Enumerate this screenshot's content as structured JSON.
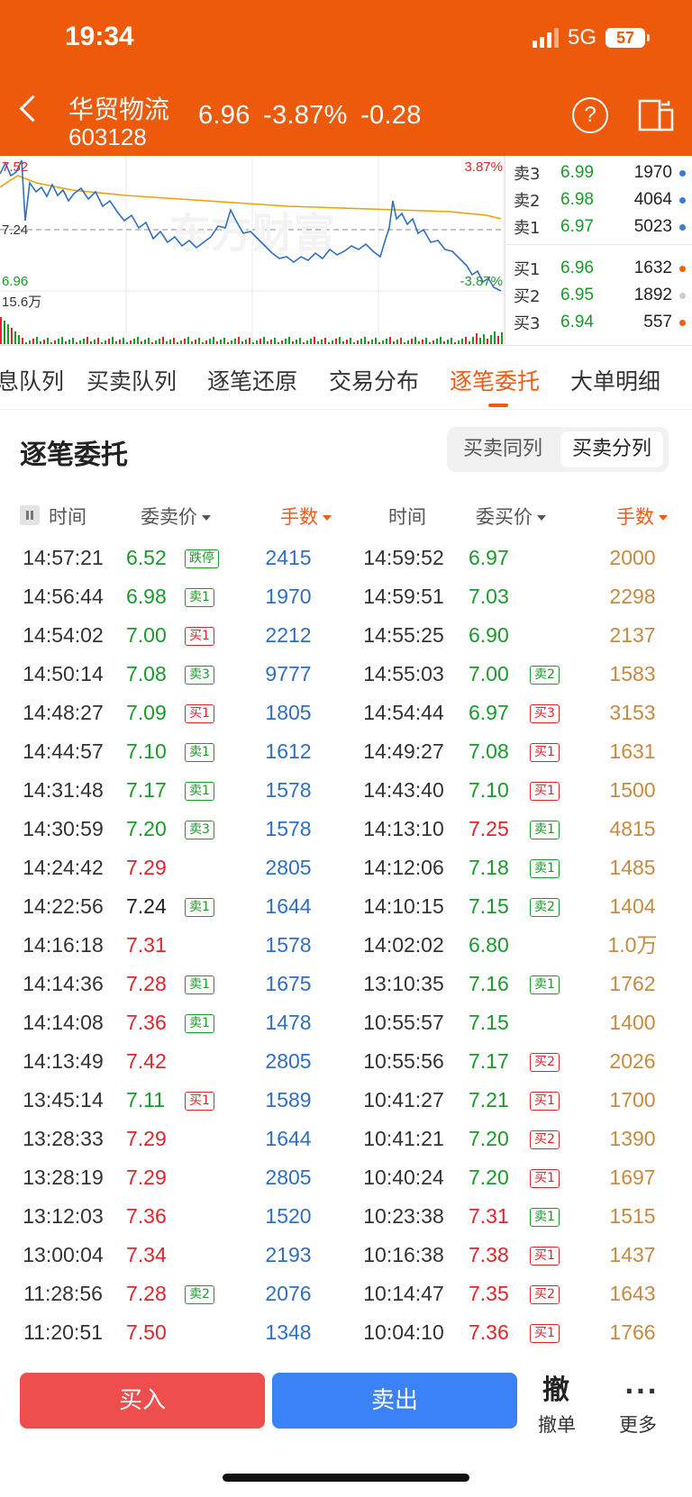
{
  "status_bar": {
    "time": "19:34",
    "network": "5G",
    "battery": "57"
  },
  "header": {
    "stock_name": "华贸物流",
    "stock_code": "603128",
    "price": "6.96",
    "change_pct": "-3.87%",
    "change": "-0.28"
  },
  "chart": {
    "price_high_label": "7.52",
    "price_low_label": "6.96",
    "pct_high_label": "3.87%",
    "pct_low_label": "-3.87%",
    "ref_label": "7.24",
    "volume_label": "15.6万",
    "watermark": "东方财富",
    "colors": {
      "price_line": "#2f6fc0",
      "avg_line": "#f0a000",
      "up": "#e0252b",
      "down": "#1a9a2a"
    }
  },
  "orderbook": {
    "asks": [
      {
        "label": "卖3",
        "price": "6.99",
        "volume": "1970",
        "dot_color": "#3b7ad8"
      },
      {
        "label": "卖2",
        "price": "6.98",
        "volume": "4064",
        "dot_color": "#3b7ad8"
      },
      {
        "label": "卖1",
        "price": "6.97",
        "volume": "5023",
        "dot_color": "#3b7ad8"
      }
    ],
    "bids": [
      {
        "label": "买1",
        "price": "6.96",
        "volume": "1632",
        "dot_color": "#f06010"
      },
      {
        "label": "买2",
        "price": "6.95",
        "volume": "1892",
        "dot_color": "#cccccc"
      },
      {
        "label": "买3",
        "price": "6.94",
        "volume": "557",
        "dot_color": "#f06010"
      }
    ]
  },
  "tabs": [
    "息队列",
    "买卖队列",
    "逐笔还原",
    "交易分布",
    "逐笔委托",
    "大单明细"
  ],
  "active_tab": "逐笔委托",
  "section": {
    "title": "逐笔委托",
    "toggle": [
      "买卖同列",
      "买卖分列"
    ],
    "selected_toggle": "买卖分列"
  },
  "columns": {
    "left": [
      "时间",
      "委卖价",
      "手数"
    ],
    "right": [
      "时间",
      "委买价",
      "手数"
    ]
  },
  "rows": [
    {
      "lt": "14:57:21",
      "lp": "6.52",
      "lc": "g",
      "lb": "跌停",
      "lbc": "g",
      "lv": "2415",
      "rt": "14:59:52",
      "rp": "6.97",
      "rc": "g",
      "rb": "",
      "rbc": "",
      "rv": "2000"
    },
    {
      "lt": "14:56:44",
      "lp": "6.98",
      "lc": "g",
      "lb": "卖1",
      "lbc": "g",
      "lv": "1970",
      "rt": "14:59:51",
      "rp": "7.03",
      "rc": "g",
      "rb": "",
      "rbc": "",
      "rv": "2298"
    },
    {
      "lt": "14:54:02",
      "lp": "7.00",
      "lc": "g",
      "lb": "买1",
      "lbc": "r",
      "lv": "2212",
      "rt": "14:55:25",
      "rp": "6.90",
      "rc": "g",
      "rb": "",
      "rbc": "",
      "rv": "2137"
    },
    {
      "lt": "14:50:14",
      "lp": "7.08",
      "lc": "g",
      "lb": "卖3",
      "lbc": "g",
      "lv": "9777",
      "rt": "14:55:03",
      "rp": "7.00",
      "rc": "g",
      "rb": "卖2",
      "rbc": "g",
      "rv": "1583"
    },
    {
      "lt": "14:48:27",
      "lp": "7.09",
      "lc": "g",
      "lb": "买1",
      "lbc": "r",
      "lv": "1805",
      "rt": "14:54:44",
      "rp": "6.97",
      "rc": "g",
      "rb": "买3",
      "rbc": "r",
      "rv": "3153"
    },
    {
      "lt": "14:44:57",
      "lp": "7.10",
      "lc": "g",
      "lb": "卖1",
      "lbc": "g",
      "lv": "1612",
      "rt": "14:49:27",
      "rp": "7.08",
      "rc": "g",
      "rb": "买1",
      "rbc": "r",
      "rv": "1631"
    },
    {
      "lt": "14:31:48",
      "lp": "7.17",
      "lc": "g",
      "lb": "卖1",
      "lbc": "g",
      "lv": "1578",
      "rt": "14:43:40",
      "rp": "7.10",
      "rc": "g",
      "rb": "买1",
      "rbc": "r",
      "rv": "1500"
    },
    {
      "lt": "14:30:59",
      "lp": "7.20",
      "lc": "g",
      "lb": "卖3",
      "lbc": "g",
      "lv": "1578",
      "rt": "14:13:10",
      "rp": "7.25",
      "rc": "r",
      "rb": "卖1",
      "rbc": "g",
      "rv": "4815"
    },
    {
      "lt": "14:24:42",
      "lp": "7.29",
      "lc": "r",
      "lb": "",
      "lbc": "",
      "lv": "2805",
      "rt": "14:12:06",
      "rp": "7.18",
      "rc": "g",
      "rb": "卖1",
      "rbc": "g",
      "rv": "1485"
    },
    {
      "lt": "14:22:56",
      "lp": "7.24",
      "lc": "k",
      "lb": "卖1",
      "lbc": "g",
      "lv": "1644",
      "rt": "14:10:15",
      "rp": "7.15",
      "rc": "g",
      "rb": "卖2",
      "rbc": "g",
      "rv": "1404"
    },
    {
      "lt": "14:16:18",
      "lp": "7.31",
      "lc": "r",
      "lb": "",
      "lbc": "",
      "lv": "1578",
      "rt": "14:02:02",
      "rp": "6.80",
      "rc": "g",
      "rb": "",
      "rbc": "",
      "rv": "1.0万"
    },
    {
      "lt": "14:14:36",
      "lp": "7.28",
      "lc": "r",
      "lb": "卖1",
      "lbc": "g",
      "lv": "1675",
      "rt": "13:10:35",
      "rp": "7.16",
      "rc": "g",
      "rb": "卖1",
      "rbc": "g",
      "rv": "1762"
    },
    {
      "lt": "14:14:08",
      "lp": "7.36",
      "lc": "r",
      "lb": "卖1",
      "lbc": "g",
      "lv": "1478",
      "rt": "10:55:57",
      "rp": "7.15",
      "rc": "g",
      "rb": "",
      "rbc": "",
      "rv": "1400"
    },
    {
      "lt": "14:13:49",
      "lp": "7.42",
      "lc": "r",
      "lb": "",
      "lbc": "",
      "lv": "2805",
      "rt": "10:55:56",
      "rp": "7.17",
      "rc": "g",
      "rb": "买2",
      "rbc": "r",
      "rv": "2026"
    },
    {
      "lt": "13:45:14",
      "lp": "7.11",
      "lc": "g",
      "lb": "买1",
      "lbc": "r",
      "lv": "1589",
      "rt": "10:41:27",
      "rp": "7.21",
      "rc": "g",
      "rb": "买1",
      "rbc": "r",
      "rv": "1700"
    },
    {
      "lt": "13:28:33",
      "lp": "7.29",
      "lc": "r",
      "lb": "",
      "lbc": "",
      "lv": "1644",
      "rt": "10:41:21",
      "rp": "7.20",
      "rc": "g",
      "rb": "买2",
      "rbc": "r",
      "rv": "1390"
    },
    {
      "lt": "13:28:19",
      "lp": "7.29",
      "lc": "r",
      "lb": "",
      "lbc": "",
      "lv": "2805",
      "rt": "10:40:24",
      "rp": "7.20",
      "rc": "g",
      "rb": "买1",
      "rbc": "r",
      "rv": "1697"
    },
    {
      "lt": "13:12:03",
      "lp": "7.36",
      "lc": "r",
      "lb": "",
      "lbc": "",
      "lv": "1520",
      "rt": "10:23:38",
      "rp": "7.31",
      "rc": "r",
      "rb": "卖1",
      "rbc": "g",
      "rv": "1515"
    },
    {
      "lt": "13:00:04",
      "lp": "7.34",
      "lc": "r",
      "lb": "",
      "lbc": "",
      "lv": "2193",
      "rt": "10:16:38",
      "rp": "7.38",
      "rc": "r",
      "rb": "买1",
      "rbc": "r",
      "rv": "1437"
    },
    {
      "lt": "11:28:56",
      "lp": "7.28",
      "lc": "r",
      "lb": "卖2",
      "lbc": "g",
      "lv": "2076",
      "rt": "10:14:47",
      "rp": "7.35",
      "rc": "r",
      "rb": "买2",
      "rbc": "r",
      "rv": "1643"
    },
    {
      "lt": "11:20:51",
      "lp": "7.50",
      "lc": "r",
      "lb": "",
      "lbc": "",
      "lv": "1348",
      "rt": "10:04:10",
      "rp": "7.36",
      "rc": "r",
      "rb": "买1",
      "rbc": "r",
      "rv": "1766"
    }
  ],
  "bottom_bar": {
    "buy_label": "买入",
    "sell_label": "卖出",
    "cancel_icon_glyph": "撤",
    "cancel_label": "撤单",
    "more_label": "更多"
  }
}
